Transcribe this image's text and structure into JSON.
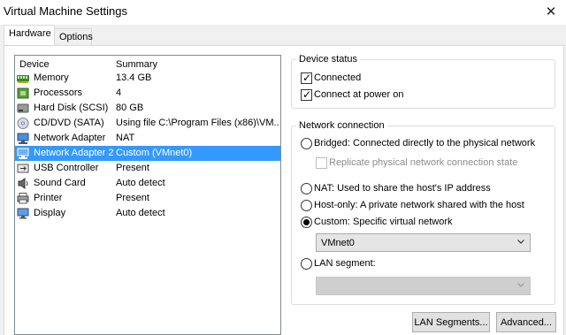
{
  "window": {
    "title": "Virtual Machine Settings",
    "close_glyph": "✕"
  },
  "tabs": [
    {
      "label": "Hardware",
      "active": true
    },
    {
      "label": "Options",
      "active": false
    }
  ],
  "device_list": {
    "columns": [
      "Device",
      "Summary"
    ],
    "rows": [
      {
        "icon": "memory-icon",
        "device": "Memory",
        "summary": "13.4 GB"
      },
      {
        "icon": "processor-icon",
        "device": "Processors",
        "summary": "4"
      },
      {
        "icon": "hard-disk-icon",
        "device": "Hard Disk (SCSI)",
        "summary": "80 GB"
      },
      {
        "icon": "cd-dvd-icon",
        "device": "CD/DVD (SATA)",
        "summary": "Using file C:\\Program Files (x86)\\VM..."
      },
      {
        "icon": "network-adapter-icon",
        "device": "Network Adapter",
        "summary": "NAT"
      },
      {
        "icon": "network-adapter-icon",
        "device": "Network Adapter 2",
        "summary": "Custom (VMnet0)",
        "selected": true
      },
      {
        "icon": "usb-controller-icon",
        "device": "USB Controller",
        "summary": "Present"
      },
      {
        "icon": "sound-card-icon",
        "device": "Sound Card",
        "summary": "Auto detect"
      },
      {
        "icon": "printer-icon",
        "device": "Printer",
        "summary": "Present"
      },
      {
        "icon": "display-icon",
        "device": "Display",
        "summary": "Auto detect"
      }
    ]
  },
  "device_status": {
    "legend": "Device status",
    "connected": {
      "label": "Connected",
      "checked": true
    },
    "connect_at_power_on": {
      "label": "Connect at power on",
      "checked": true
    }
  },
  "network_connection": {
    "legend": "Network connection",
    "bridged": {
      "label": "Bridged: Connected directly to the physical network",
      "selected": false
    },
    "replicate": {
      "label": "Replicate physical network connection state",
      "checked": false,
      "enabled": false
    },
    "nat": {
      "label": "NAT: Used to share the host's IP address",
      "selected": false
    },
    "host_only": {
      "label": "Host-only: A private network shared with the host",
      "selected": false
    },
    "custom": {
      "label": "Custom: Specific virtual network",
      "selected": true
    },
    "custom_network_value": "VMnet0",
    "lan_segment": {
      "label": "LAN segment:",
      "selected": false
    },
    "lan_segment_value": ""
  },
  "buttons": {
    "lan_segments": "LAN Segments...",
    "advanced": "Advanced..."
  },
  "colors": {
    "selection": "#3399ff",
    "panel_background": "#ffffff",
    "window_background": "#f0f0f0"
  }
}
